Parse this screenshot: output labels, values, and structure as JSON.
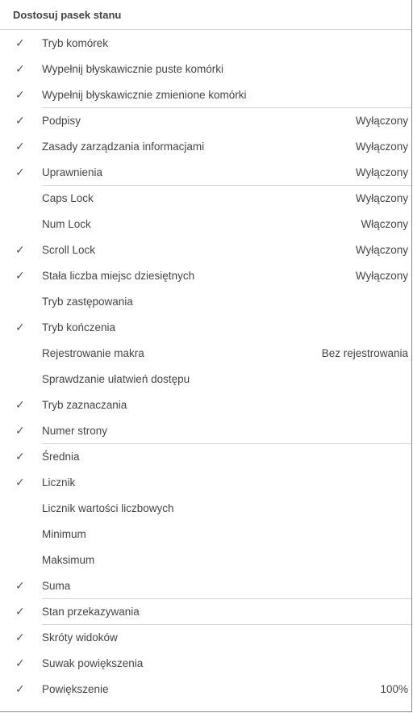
{
  "menu": {
    "title": "Dostosuj pasek stanu",
    "items": [
      {
        "label": "Tryb komórek",
        "value": "",
        "checked": true
      },
      {
        "label": "Wypełnij błyskawicznie puste komórki",
        "value": "",
        "checked": true
      },
      {
        "label": "Wypełnij błyskawicznie zmienione komórki",
        "value": "",
        "checked": true
      },
      {
        "label": "Podpisy",
        "value": "Wyłączony",
        "checked": true
      },
      {
        "label": "Zasady zarządzania informacjami",
        "value": "Wyłączony",
        "checked": true
      },
      {
        "label": "Uprawnienia",
        "value": "Wyłączony",
        "checked": true
      },
      {
        "label": "Caps Lock",
        "value": "Wyłączony",
        "checked": false
      },
      {
        "label": "Num Lock",
        "value": "Włączony",
        "checked": false
      },
      {
        "label": "Scroll Lock",
        "value": "Wyłączony",
        "checked": true
      },
      {
        "label": "Stała liczba miejsc dziesiętnych",
        "value": "Wyłączony",
        "checked": true
      },
      {
        "label": "Tryb zastępowania",
        "value": "",
        "checked": false
      },
      {
        "label": "Tryb kończenia",
        "value": "",
        "checked": true
      },
      {
        "label": "Rejestrowanie makra",
        "value": "Bez rejestrowania",
        "checked": false
      },
      {
        "label": "Sprawdzanie ułatwień dostępu",
        "value": "",
        "checked": false
      },
      {
        "label": "Tryb zaznaczania",
        "value": "",
        "checked": true
      },
      {
        "label": "Numer strony",
        "value": "",
        "checked": true
      },
      {
        "label": "Średnia",
        "value": "",
        "checked": true
      },
      {
        "label": "Licznik",
        "value": "",
        "checked": true
      },
      {
        "label": "Licznik wartości liczbowych",
        "value": "",
        "checked": false
      },
      {
        "label": "Minimum",
        "value": "",
        "checked": false
      },
      {
        "label": "Maksimum",
        "value": "",
        "checked": false
      },
      {
        "label": "Suma",
        "value": "",
        "checked": true
      },
      {
        "label": "Stan przekazywania",
        "value": "",
        "checked": true
      },
      {
        "label": "Skróty widoków",
        "value": "",
        "checked": true
      },
      {
        "label": "Suwak powiększenia",
        "value": "",
        "checked": true
      },
      {
        "label": "Powiększenie",
        "value": "100%",
        "checked": true
      }
    ]
  },
  "icons": {
    "checkmark": "✓"
  }
}
